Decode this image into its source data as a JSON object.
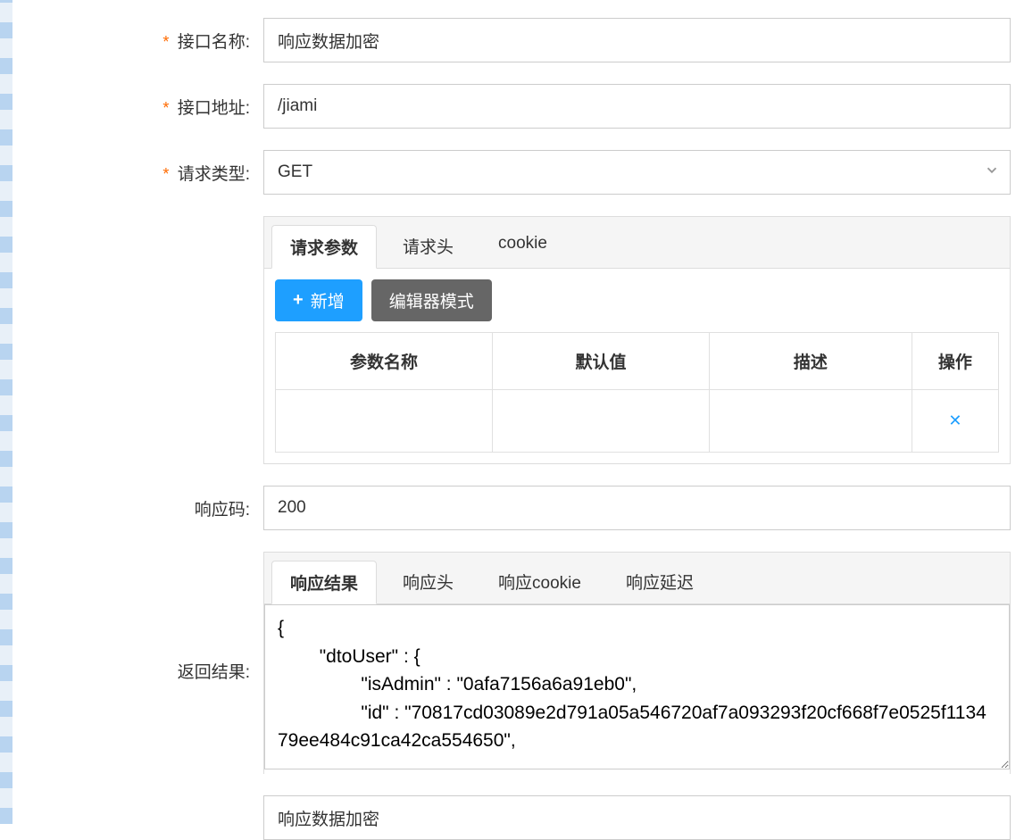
{
  "labels": {
    "interface_name": "接口名称:",
    "interface_url": "接口地址:",
    "request_type": "请求类型:",
    "response_code": "响应码:",
    "return_result": "返回结果:"
  },
  "values": {
    "interface_name": "响应数据加密",
    "interface_url": "/jiami",
    "request_type": "GET",
    "response_code": "200",
    "bottom_input": "响应数据加密"
  },
  "request_tabs": {
    "params": "请求参数",
    "headers": "请求头",
    "cookie": "cookie"
  },
  "toolbar": {
    "add": "新增",
    "editor_mode": "编辑器模式"
  },
  "params_table": {
    "col_name": "参数名称",
    "col_default": "默认值",
    "col_desc": "描述",
    "col_action": "操作"
  },
  "response_tabs": {
    "result": "响应结果",
    "headers": "响应头",
    "cookie": "响应cookie",
    "delay": "响应延迟"
  },
  "response_body": "{\n        \"dtoUser\" : {\n                \"isAdmin\" : \"0afa7156a6a91eb0\",\n                \"id\" : \"70817cd03089e2d791a05a546720af7a093293f20cf668f7e0525f113479ee484c91ca42ca554650\","
}
